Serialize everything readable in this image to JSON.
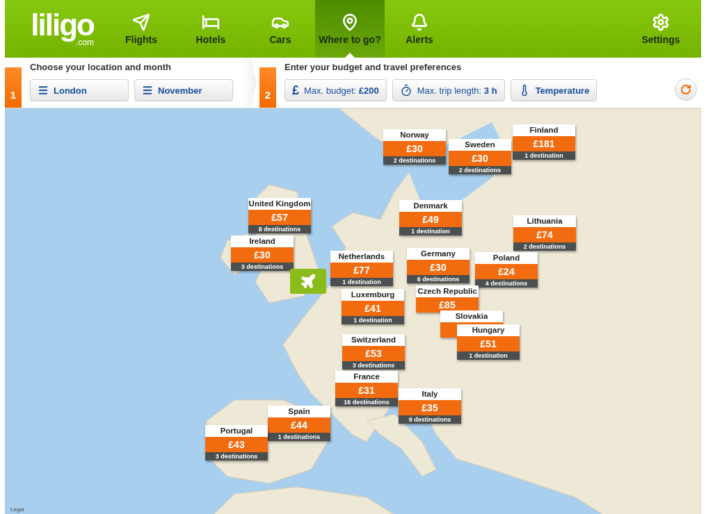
{
  "logo": {
    "name": "liligo",
    "suffix": ".com"
  },
  "nav": [
    {
      "label": "Flights",
      "kind": "plane",
      "selected": false
    },
    {
      "label": "Hotels",
      "kind": "bed",
      "selected": false
    },
    {
      "label": "Cars",
      "kind": "car",
      "selected": false
    },
    {
      "label": "Where to go?",
      "kind": "pin",
      "selected": true
    },
    {
      "label": "Alerts",
      "kind": "bell",
      "selected": false
    }
  ],
  "settings": {
    "label": "Settings"
  },
  "step1": {
    "number": "1",
    "title": "Choose your location and month",
    "buttons": [
      {
        "label": "London"
      },
      {
        "label": "November"
      }
    ]
  },
  "step2": {
    "number": "2",
    "title": "Enter your budget and travel preferences",
    "filters": [
      {
        "kind": "budget",
        "symbol": "£",
        "label": "Max. budget: **£200**"
      },
      {
        "kind": "duration",
        "label": "Max. trip length: **3 h**"
      },
      {
        "kind": "temperature",
        "label": "Temperature"
      }
    ]
  },
  "map": {
    "legal": "Legal",
    "markers": [
      {
        "country": "Norway",
        "price": "£30",
        "count": "2 destinations"
      },
      {
        "country": "Sweden",
        "price": "£30",
        "count": "2 destinations"
      },
      {
        "country": "Finland",
        "price": "£181",
        "count": "1 destination"
      },
      {
        "country": "United Kingdom",
        "price": "£57",
        "count": "8 destinations"
      },
      {
        "country": "Denmark",
        "price": "£49",
        "count": "1 destination"
      },
      {
        "country": "Lithuania",
        "price": "£74",
        "count": "2 destinations"
      },
      {
        "country": "Ireland",
        "price": "£30",
        "count": "3 destinations"
      },
      {
        "country": "Netherlands",
        "price": "£77",
        "count": "1 destination"
      },
      {
        "country": "Germany",
        "price": "£30",
        "count": "6 destinations"
      },
      {
        "country": "Poland",
        "price": "£24",
        "count": "4 destinations"
      },
      {
        "country": "Luxemburg",
        "price": "£41",
        "count": "1 destination"
      },
      {
        "country": "Czech Republic",
        "price": "£85"
      },
      {
        "country": "Slovakia"
      },
      {
        "country": "Hungary",
        "price": "£51",
        "count": "1 destination"
      },
      {
        "country": "Switzerland",
        "price": "£53",
        "count": "3 destinations"
      },
      {
        "country": "France",
        "price": "£31",
        "count": "16 destinations"
      },
      {
        "country": "Italy",
        "price": "£35",
        "count": "9 destinations"
      },
      {
        "country": "Spain",
        "price": "£44",
        "count": "1 destinations"
      },
      {
        "country": "Portugal",
        "price": "£43",
        "count": "3 destinations"
      }
    ]
  }
}
